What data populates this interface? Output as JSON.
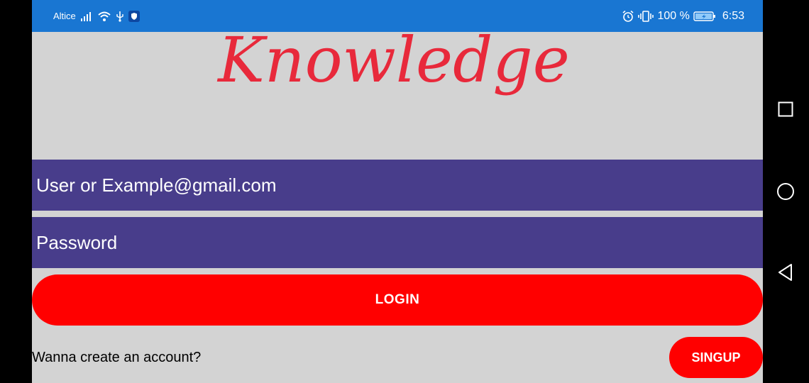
{
  "status_bar": {
    "carrier": "Altice",
    "battery_text": "100 %",
    "time": "6:53",
    "icons": [
      "signal-icon",
      "wifi-icon",
      "usb-icon",
      "shield-icon",
      "alarm-icon",
      "vibrate-icon",
      "battery-charging-icon"
    ]
  },
  "logo": {
    "text": "Knowledge",
    "color": "#e8293b"
  },
  "login_form": {
    "user_placeholder": "User or Example@gmail.com",
    "password_placeholder": "Password",
    "login_label": "LOGIN"
  },
  "signup": {
    "prompt": "Wanna create an account?",
    "button_label": "SINGUP"
  },
  "nav_bar": {
    "icons": [
      "recent-apps-icon",
      "home-icon",
      "back-icon"
    ]
  },
  "colors": {
    "status_bar": "#1976d2",
    "background": "#d3d3d3",
    "field": "#483d8b",
    "button": "#ff0000"
  }
}
